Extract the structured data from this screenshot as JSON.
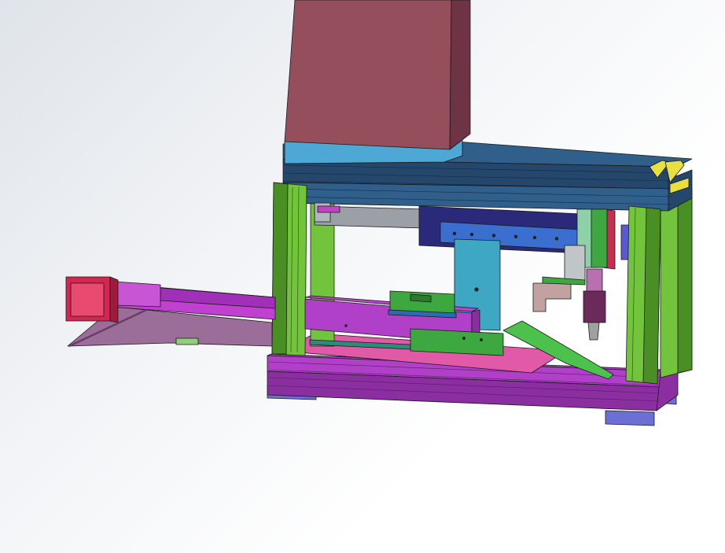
{
  "viewport": {
    "background_top": "#dfe4ea",
    "background_bottom": "#ffffff"
  },
  "model": {
    "colors": {
      "tower_front": "#944e5c",
      "tower_side": "#6e3344",
      "tower_top": "#a7606e",
      "top_plate_light": "#4ea8d6",
      "top_rail_blue": "#2f5f8a",
      "top_rail_dark": "#24476b",
      "frame_green": "#72c43c",
      "frame_green_dark": "#4a8f24",
      "base_magenta": "#b040c8",
      "base_magenta_dark": "#8a2ea0",
      "base_pink": "#e05aa8",
      "feet_blue": "#6b6fd6",
      "cylinder_gray": "#9aa0a6",
      "slide_navy": "#2b2a7a",
      "slide_blue": "#3a6fd0",
      "column_cyan": "#3ea7c4",
      "clamp_green": "#3ea840",
      "ramp_green": "#4cc24c",
      "motor_red": "#d42650",
      "arm_magenta": "#c040d0",
      "arm_gray": "#9a6e98",
      "gripper_tan": "#c2a2a0",
      "gripper_purple": "#6a2a5a",
      "accent_yellow": "#e8e040",
      "edge_line": "#1a1a1a"
    }
  }
}
